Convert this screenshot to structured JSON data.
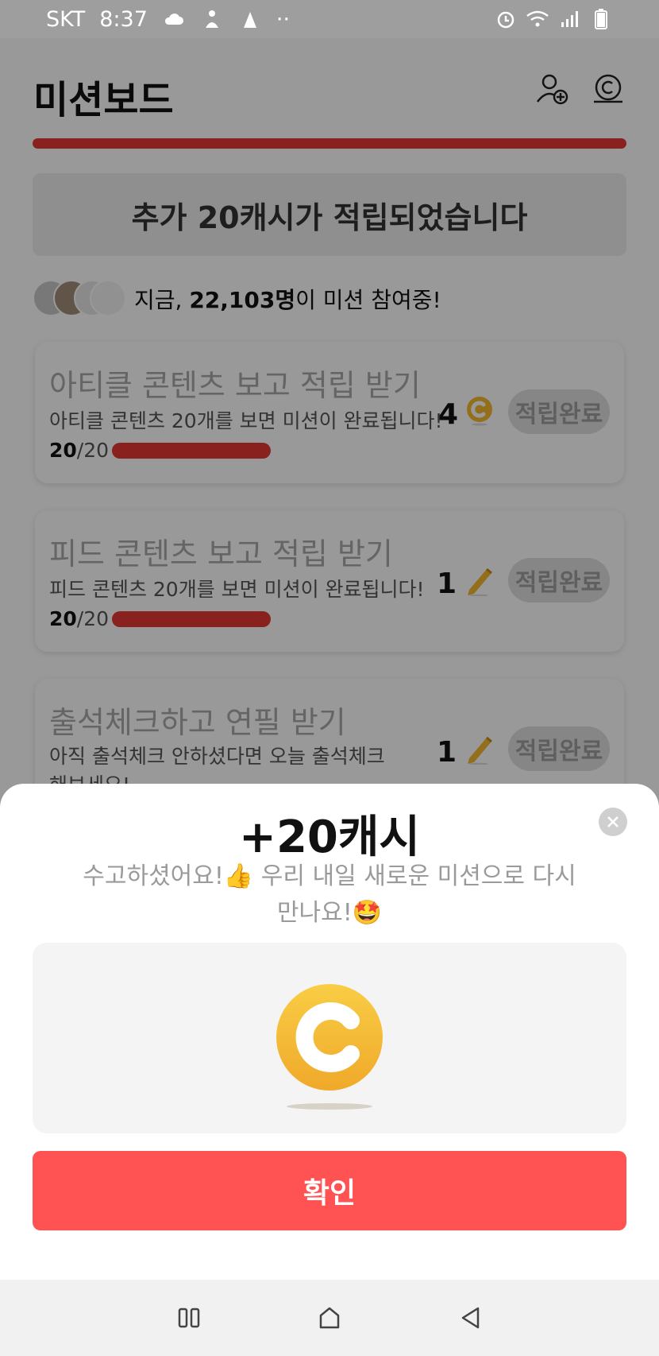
{
  "status_bar": {
    "carrier": "SKT",
    "time": "8:37",
    "battery": "7"
  },
  "header": {
    "title": "미션보드",
    "add_friend_icon": "person-add-icon",
    "cash_icon": "coin-stack-icon"
  },
  "top_progress": {
    "fraction": 1.0
  },
  "banner": {
    "text": "추가 20캐시가 적립되었습니다"
  },
  "participants": {
    "prefix": "지금, ",
    "count": "22,103명",
    "suffix": "이 미션 참여중!"
  },
  "missions": [
    {
      "title": "아티클 콘텐츠 보고 적립 받기",
      "desc": "아티클 콘텐츠 20개를 보면 미션이 완료됩니다!",
      "done": "20",
      "total": "/20",
      "progress": 1.0,
      "reward": "4",
      "reward_icon": "coin-icon",
      "button": "적립완료"
    },
    {
      "title": "피드 콘텐츠 보고 적립 받기",
      "desc": "피드 콘텐츠 20개를 보면 미션이 완료됩니다!",
      "done": "20",
      "total": "/20",
      "progress": 1.0,
      "reward": "1",
      "reward_icon": "pencil-icon",
      "button": "적립완료"
    },
    {
      "title": "출석체크하고 연필 받기",
      "desc": "아직 출석체크 안하셨다면 오늘 출석체크해보세요!",
      "reward": "1",
      "reward_icon": "pencil-icon",
      "button": "적립완료"
    }
  ],
  "sheet": {
    "title": "+20캐시",
    "message_line1": "수고하셨어요!👍 우리 내일 새로운 미션으로 다시",
    "message_line2": "만나요!🤩",
    "confirm": "확인",
    "coin_icon": "cash-coin-icon",
    "close_icon": "close-icon"
  },
  "colors": {
    "accent": "#e53935",
    "confirm": "#ff5252",
    "coin": "#f5b82e"
  },
  "nav": {
    "recents_icon": "recents-icon",
    "home_icon": "home-icon",
    "back_icon": "back-icon"
  }
}
